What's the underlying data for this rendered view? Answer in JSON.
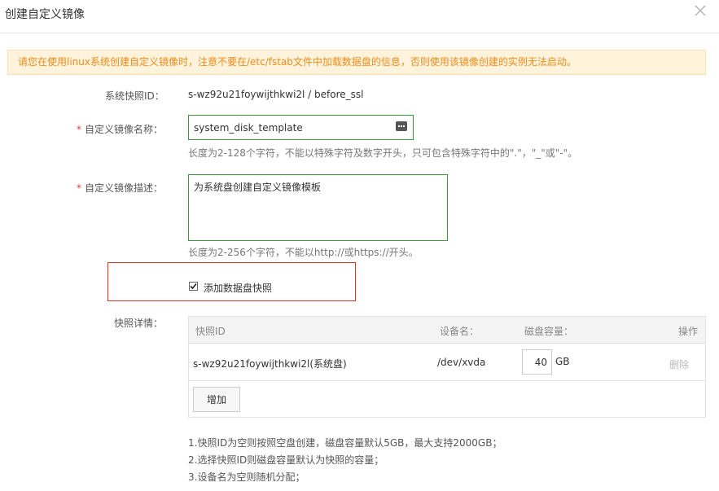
{
  "dialog": {
    "title": "创建自定义镜像"
  },
  "alert": {
    "text": "请您在使用linux系统创建自定义镜像时，注意不要在/etc/fstab文件中加载数据盘的信息，否则使用该镜像创建的实例无法启动。",
    "color": "#f08b1a"
  },
  "form": {
    "snapshot_id_label": "系统快照ID：",
    "snapshot_id_value": "s-wz92u21foywijthkwi2l /   before_ssl",
    "name_required": "*",
    "name_label": "自定义镜像名称：",
    "name_value": "system_disk_template",
    "name_hint": "长度为2-128个字符，不能以特殊字符及数字开头，只可包含特殊字符中的\".\"，\"_\"或\"-\"。",
    "desc_required": "*",
    "desc_label": "自定义镜像描述：",
    "desc_value": "为系统盘创建自定义镜像模板",
    "desc_hint": "长度为2-256个字符，不能以http://或https://开头。",
    "add_data_disk_label": "添加数据盘快照",
    "add_data_disk_checked": true,
    "details_label": "快照详情："
  },
  "table": {
    "headers": {
      "snapshot_id": "快照ID",
      "device": "设备名：",
      "capacity": "磁盘容量：",
      "action": "操作"
    },
    "rows": [
      {
        "snapshot_id": "s-wz92u21foywijthkwi2l(系统盘)",
        "device": "/dev/xvda",
        "capacity": "40",
        "unit": "GB",
        "action": "删除"
      }
    ],
    "add_button": "增加"
  },
  "notes": [
    "1.快照ID为空则按照空盘创建，磁盘容量默认5GB，最大支持2000GB；",
    "2.选择快照ID则磁盘容量默认为快照的容量；",
    "3.设备名为空则随机分配；"
  ],
  "colors": {
    "border_green": "#3a9b3a",
    "highlight_red": "#d9332b",
    "required_red": "#e0413b"
  }
}
